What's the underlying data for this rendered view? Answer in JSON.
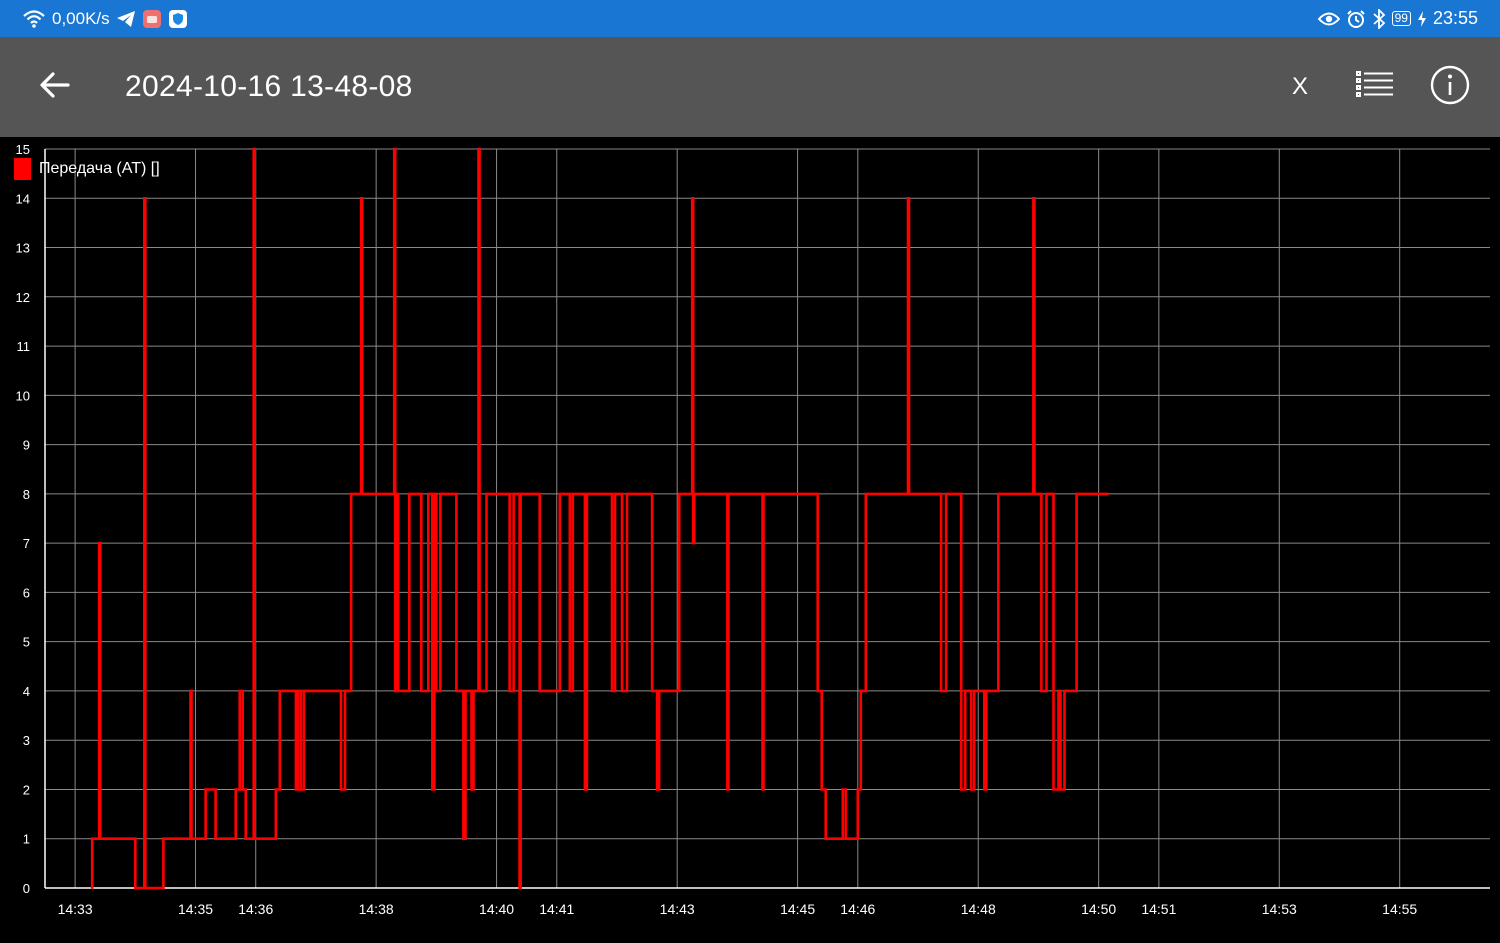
{
  "status_bar": {
    "net_speed": "0,00K/s",
    "battery": "99",
    "time": "23:55",
    "icons_left": [
      "wifi-icon",
      "telegram-icon",
      "notification-app-icon",
      "shield-app-icon"
    ],
    "icons_right": [
      "eye-icon",
      "alarm-icon",
      "bluetooth-icon",
      "battery-icon",
      "charging-icon"
    ]
  },
  "toolbar": {
    "title": "2024-10-16 13-48-08",
    "x_label": "X",
    "back_icon": "arrow-left-icon",
    "list_icon": "list-icon",
    "info_icon": "info-icon"
  },
  "colors": {
    "status_bar": "#1976d2",
    "toolbar": "#555555",
    "background": "#000000",
    "series": "#ff0000",
    "grid": "#8a8a8a"
  },
  "chart_data": {
    "type": "line",
    "title": "",
    "xlabel": "",
    "ylabel": "",
    "ylim": [
      0,
      15
    ],
    "yticks": [
      0,
      1,
      2,
      3,
      4,
      5,
      6,
      7,
      8,
      9,
      10,
      11,
      12,
      13,
      14,
      15
    ],
    "xlim": [
      "14:32:30",
      "14:56:30"
    ],
    "xticks": [
      "14:33",
      "14:35",
      "14:36",
      "14:38",
      "14:40",
      "14:41",
      "14:43",
      "14:45",
      "14:46",
      "14:48",
      "14:50",
      "14:51",
      "14:53",
      "14:55"
    ],
    "grid": true,
    "legend_position": "top-left",
    "series": [
      {
        "name": "Передача (AT) []",
        "color": "#ff0000",
        "step": true,
        "points": [
          [
            "14:33:16",
            0
          ],
          [
            "14:33:17",
            1
          ],
          [
            "14:33:24",
            7
          ],
          [
            "14:33:25",
            1
          ],
          [
            "14:34:00",
            0
          ],
          [
            "14:34:09",
            14
          ],
          [
            "14:34:10",
            0
          ],
          [
            "14:34:28",
            1
          ],
          [
            "14:34:55",
            4
          ],
          [
            "14:34:56",
            1
          ],
          [
            "14:35:10",
            2
          ],
          [
            "14:35:20",
            1
          ],
          [
            "14:35:40",
            2
          ],
          [
            "14:35:44",
            4
          ],
          [
            "14:35:47",
            2
          ],
          [
            "14:35:50",
            1
          ],
          [
            "14:35:58",
            15
          ],
          [
            "14:35:59",
            1
          ],
          [
            "14:36:20",
            2
          ],
          [
            "14:36:24",
            4
          ],
          [
            "14:36:40",
            2
          ],
          [
            "14:36:42",
            4
          ],
          [
            "14:36:45",
            2
          ],
          [
            "14:36:48",
            4
          ],
          [
            "14:37:25",
            2
          ],
          [
            "14:37:29",
            4
          ],
          [
            "14:37:35",
            8
          ],
          [
            "14:37:45",
            14
          ],
          [
            "14:37:46",
            8
          ],
          [
            "14:38:18",
            15
          ],
          [
            "14:38:19",
            4
          ],
          [
            "14:38:21",
            8
          ],
          [
            "14:38:22",
            4
          ],
          [
            "14:38:33",
            8
          ],
          [
            "14:38:45",
            4
          ],
          [
            "14:38:52",
            8
          ],
          [
            "14:38:56",
            2
          ],
          [
            "14:38:58",
            8
          ],
          [
            "14:39:00",
            4
          ],
          [
            "14:39:04",
            8
          ],
          [
            "14:39:20",
            4
          ],
          [
            "14:39:27",
            1
          ],
          [
            "14:39:29",
            4
          ],
          [
            "14:39:35",
            2
          ],
          [
            "14:39:37",
            4
          ],
          [
            "14:39:42",
            15
          ],
          [
            "14:39:43",
            4
          ],
          [
            "14:39:50",
            8
          ],
          [
            "14:40:13",
            4
          ],
          [
            "14:40:17",
            8
          ],
          [
            "14:40:23",
            0
          ],
          [
            "14:40:24",
            8
          ],
          [
            "14:40:43",
            4
          ],
          [
            "14:41:03",
            8
          ],
          [
            "14:41:13",
            4
          ],
          [
            "14:41:16",
            8
          ],
          [
            "14:41:28",
            2
          ],
          [
            "14:41:30",
            8
          ],
          [
            "14:41:55",
            4
          ],
          [
            "14:41:58",
            8
          ],
          [
            "14:42:05",
            4
          ],
          [
            "14:42:10",
            8
          ],
          [
            "14:42:35",
            4
          ],
          [
            "14:42:38",
            4
          ],
          [
            "14:42:40",
            2
          ],
          [
            "14:42:42",
            4
          ],
          [
            "14:43:02",
            8
          ],
          [
            "14:43:15",
            14
          ],
          [
            "14:43:16",
            7
          ],
          [
            "14:43:17",
            8
          ],
          [
            "14:43:50",
            2
          ],
          [
            "14:43:51",
            8
          ],
          [
            "14:44:25",
            2
          ],
          [
            "14:44:26",
            8
          ],
          [
            "14:45:20",
            4
          ],
          [
            "14:45:24",
            2
          ],
          [
            "14:45:28",
            1
          ],
          [
            "14:45:45",
            2
          ],
          [
            "14:45:48",
            1
          ],
          [
            "14:46:00",
            2
          ],
          [
            "14:46:03",
            4
          ],
          [
            "14:46:08",
            8
          ],
          [
            "14:46:50",
            14
          ],
          [
            "14:46:51",
            8
          ],
          [
            "14:47:23",
            4
          ],
          [
            "14:47:28",
            8
          ],
          [
            "14:47:43",
            2
          ],
          [
            "14:47:47",
            4
          ],
          [
            "14:47:53",
            2
          ],
          [
            "14:47:56",
            4
          ],
          [
            "14:48:06",
            2
          ],
          [
            "14:48:08",
            4
          ],
          [
            "14:48:20",
            8
          ],
          [
            "14:48:55",
            14
          ],
          [
            "14:48:56",
            8
          ],
          [
            "14:49:00",
            8
          ],
          [
            "14:49:03",
            4
          ],
          [
            "14:49:08",
            8
          ],
          [
            "14:49:15",
            2
          ],
          [
            "14:49:20",
            4
          ],
          [
            "14:49:22",
            2
          ],
          [
            "14:49:26",
            4
          ],
          [
            "14:49:38",
            8
          ],
          [
            "14:50:00",
            8
          ],
          [
            "14:50:10",
            8
          ]
        ]
      }
    ]
  }
}
